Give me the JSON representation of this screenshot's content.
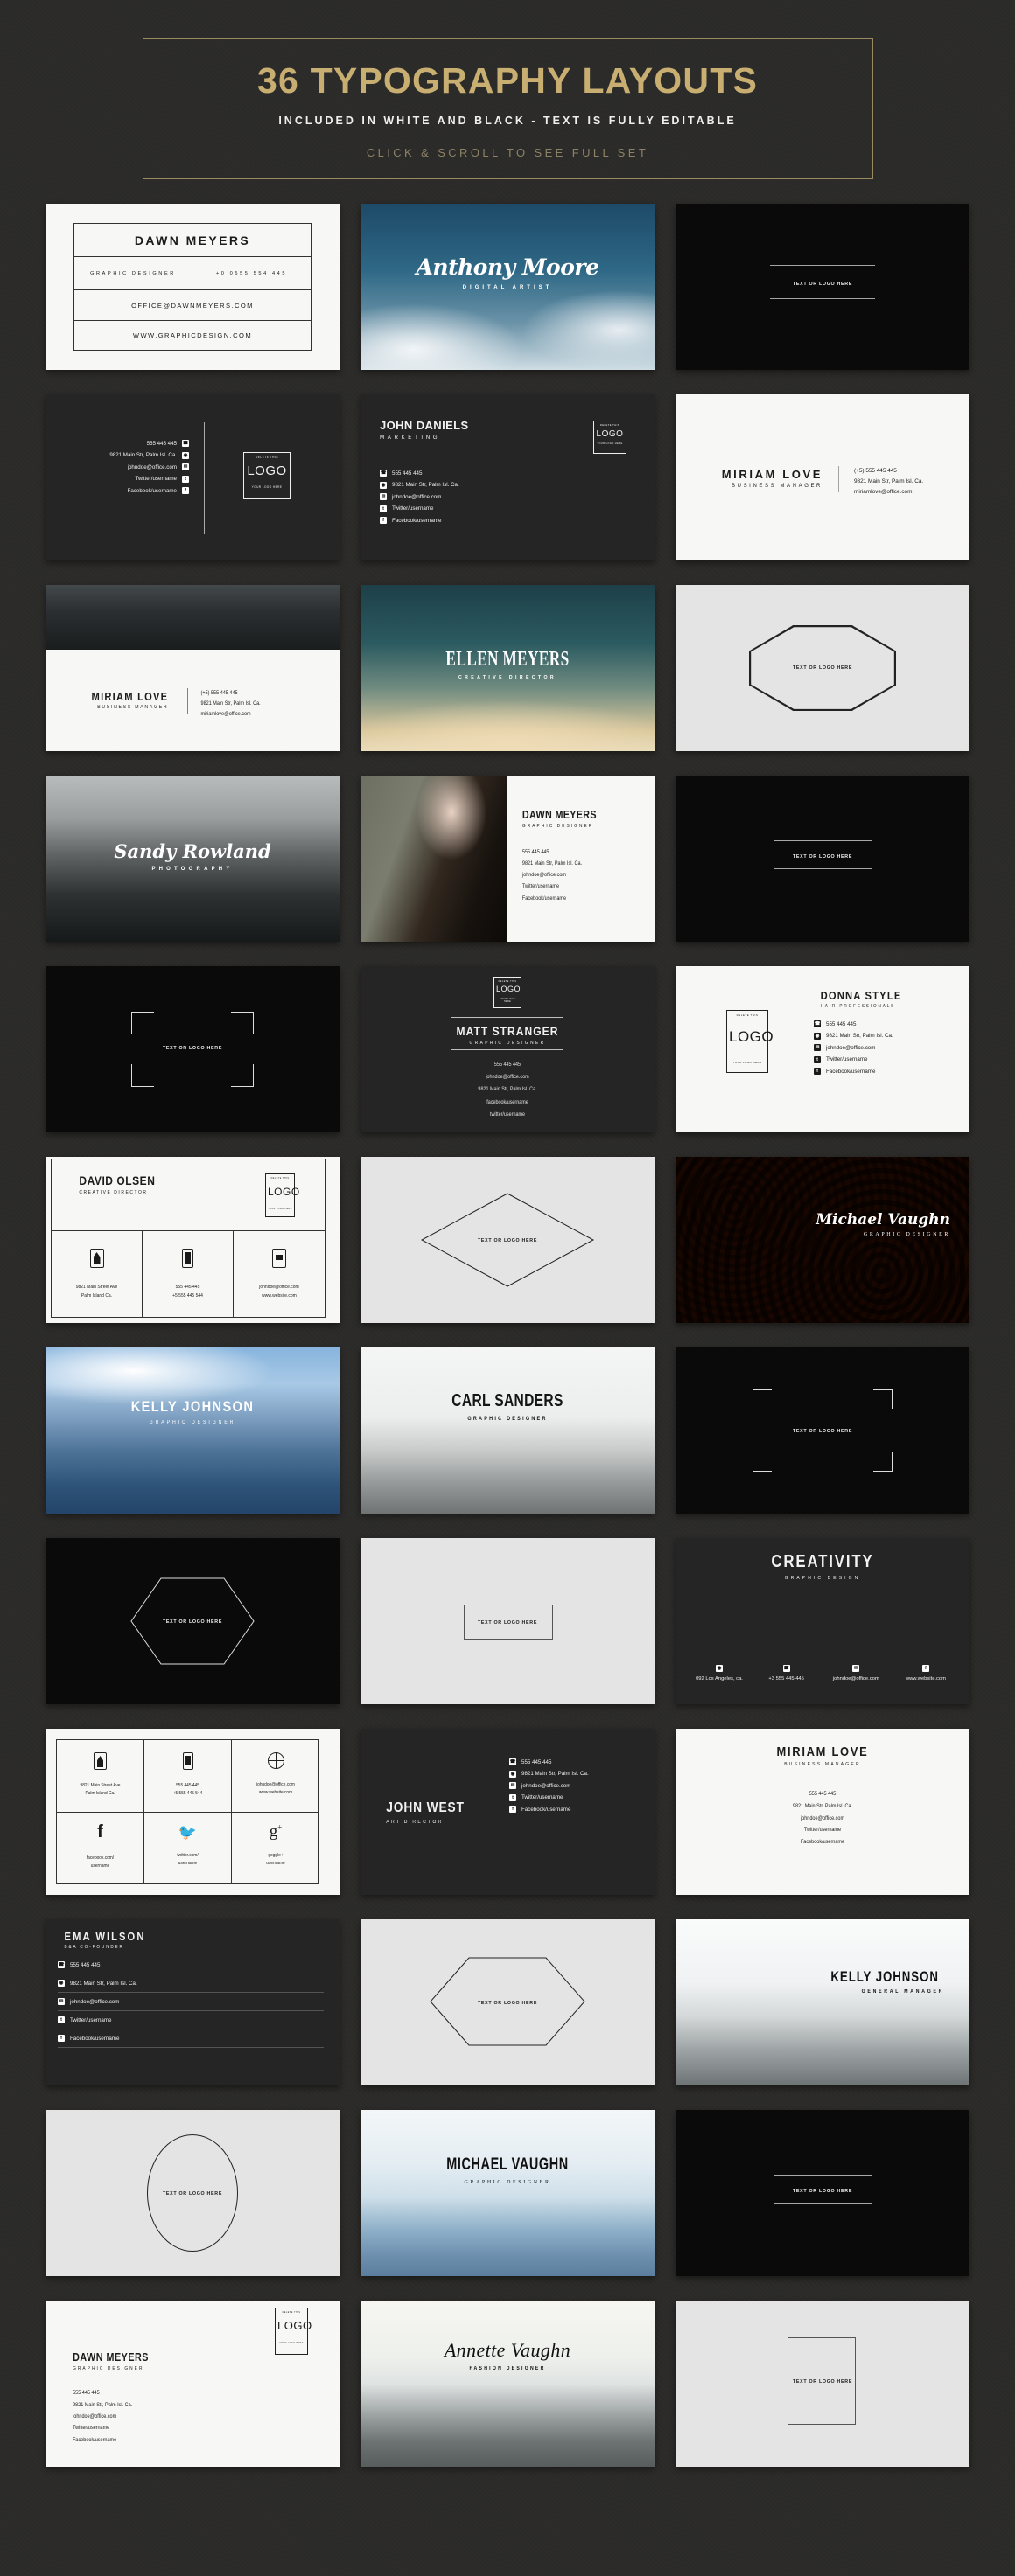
{
  "header": {
    "title": "36 TYPOGRAPHY LAYOUTS",
    "subtitle": "INCLUDED IN WHITE AND BLACK - TEXT IS FULLY EDITABLE",
    "cta": "CLICK & SCROLL TO SEE FULL SET",
    "accent_color": "#c9ae72",
    "border_color": "#9a8a5f",
    "background_color": "#2b2a28"
  },
  "placeholder": {
    "text_or_logo": "TEXT OR LOGO HERE",
    "delete_this": "DELETE THIS",
    "logo": "LOGO",
    "your_logo_here": "YOUR LOGO HERE"
  },
  "contact": {
    "phone": "555 445 445",
    "phone_plus": "(+5) 555 445 445",
    "phone_plus0": "+0 0555 554 445",
    "phone_plus3": "+3 555 445 445",
    "phone_alt": "+5 555 445 544",
    "address": "9821 Main Str, Palm Isl. Ca.",
    "address_ave": "9821 Main Street Ave",
    "address_city": "Palm Island Ca.",
    "address_la": "092 Los Angeles, ca.",
    "email": "johndoe@office.com",
    "email_office": "OFFICE@DAWNMEYERS.COM",
    "email_miriam": "miriamlove@office.com",
    "twitter": "Twitter/username",
    "twitter_lc": "twitter/username",
    "facebook": "Facebook/username",
    "facebook_lc": "facebook/username",
    "website": "www.website.com",
    "website_caps": "WWW.GRAPHICDESIGN.COM",
    "facebook_url": "facebook.com/",
    "twitter_url": "twitter.com/",
    "google_url": "goggle+",
    "username": "username"
  },
  "cards": [
    {
      "id": 1,
      "name": "DAWN MEYERS",
      "role": "GRAPHIC DESIGNER",
      "style": "boxed-table-white",
      "theme": "white"
    },
    {
      "id": 2,
      "name": "Anthony Moore",
      "role": "DIGITAL ARTIST",
      "style": "photo-script-sky",
      "theme": "photo"
    },
    {
      "id": 3,
      "name": "",
      "role": "",
      "style": "black-lines-placeholder",
      "theme": "black"
    },
    {
      "id": 4,
      "name": "",
      "role": "",
      "style": "dark-contacts-right-logo",
      "theme": "dark"
    },
    {
      "id": 5,
      "name": "JOHN DANIELS",
      "role": "MARKETING",
      "style": "dark-header-contacts-logo",
      "theme": "dark"
    },
    {
      "id": 6,
      "name": "MIRIAM LOVE",
      "role": "BUSINESS MANAGER",
      "style": "white-split-divider",
      "theme": "white"
    },
    {
      "id": 7,
      "name": "MIRIAM LOVE",
      "role": "BUSINESS MANAGER",
      "style": "photo-top-white-bottom",
      "theme": "white"
    },
    {
      "id": 8,
      "name": "ELLEN MEYERS",
      "role": "CREATIVE DIRECTOR",
      "style": "photo-dusk-serif",
      "theme": "photo"
    },
    {
      "id": 9,
      "name": "",
      "role": "",
      "style": "octagon-placeholder",
      "theme": "offwhite"
    },
    {
      "id": 10,
      "name": "Sandy Rowland",
      "role": "PHOTOGRAPHY",
      "style": "photo-script-mountain",
      "theme": "photo"
    },
    {
      "id": 11,
      "name": "DAWN MEYERS",
      "role": "GRAPHIC DESIGNER",
      "style": "portrait-left-info-right",
      "theme": "white"
    },
    {
      "id": 12,
      "name": "",
      "role": "",
      "style": "black-two-rules-placeholder",
      "theme": "black"
    },
    {
      "id": 13,
      "name": "",
      "role": "",
      "style": "black-corner-brackets",
      "theme": "black"
    },
    {
      "id": 14,
      "name": "MATT STRANGER",
      "role": "GRAPHIC DESIGNER",
      "style": "dark-centered-logo-top",
      "theme": "dark"
    },
    {
      "id": 15,
      "name": "DONNA STYLE",
      "role": "HAIR PROFESSIONALS",
      "style": "white-logo-left-contacts",
      "theme": "white"
    },
    {
      "id": 16,
      "name": "DAVID OLSEN",
      "role": "CREATIVE DIRECTOR",
      "style": "white-grid-icons",
      "theme": "white"
    },
    {
      "id": 17,
      "name": "",
      "role": "",
      "style": "diamond-placeholder",
      "theme": "offwhite"
    },
    {
      "id": 18,
      "name": "Michael Vaughn",
      "role": "GRAPHIC DESIGNER",
      "style": "photo-coffee-script",
      "theme": "photo"
    },
    {
      "id": 19,
      "name": "KELLY JOHNSON",
      "role": "GRAPHIC DESIGNER",
      "style": "photo-blue-mountain",
      "theme": "photo"
    },
    {
      "id": 20,
      "name": "CARL SANDERS",
      "role": "GRAPHIC DESIGNER",
      "style": "photo-grey-mountain",
      "theme": "photo"
    },
    {
      "id": 21,
      "name": "",
      "role": "",
      "style": "black-corner-brackets-wide",
      "theme": "black"
    },
    {
      "id": 22,
      "name": "",
      "role": "",
      "style": "black-hexagon-placeholder",
      "theme": "black"
    },
    {
      "id": 23,
      "name": "",
      "role": "",
      "style": "rect-placeholder-offwhite",
      "theme": "offwhite"
    },
    {
      "id": 24,
      "name": "CREATIVITY",
      "role": "GRAPHIC DESIGN",
      "style": "dark-footer-icons",
      "theme": "dark"
    },
    {
      "id": 25,
      "name": "",
      "role": "",
      "style": "white-icon-matrix",
      "theme": "white"
    },
    {
      "id": 26,
      "name": "JOHN WEST",
      "role": "ART DIRECTOR",
      "style": "dark-left-name-right-contacts",
      "theme": "dark"
    },
    {
      "id": 27,
      "name": "MIRIAM LOVE",
      "role": "BUSINESS MANAGER",
      "style": "white-centered-stack",
      "theme": "white"
    },
    {
      "id": 28,
      "name": "EMA WILSON",
      "role": "B&A CO-FOUNDER",
      "style": "dark-ruled-contacts",
      "theme": "dark"
    },
    {
      "id": 29,
      "name": "",
      "role": "",
      "style": "hexagon-wide-placeholder",
      "theme": "offwhite"
    },
    {
      "id": 30,
      "name": "KELLY JOHNSON",
      "role": "GENERAL MANAGER",
      "style": "photo-white-mountain",
      "theme": "photo"
    },
    {
      "id": 31,
      "name": "",
      "role": "",
      "style": "ellipse-placeholder",
      "theme": "offwhite"
    },
    {
      "id": 32,
      "name": "MICHAEL VAUGHN",
      "role": "GRAPHIC DESIGNER",
      "style": "photo-light-blue-mountain",
      "theme": "photo"
    },
    {
      "id": 33,
      "name": "",
      "role": "",
      "style": "black-two-rules-placeholder-2",
      "theme": "black"
    },
    {
      "id": 34,
      "name": "DAWN MEYERS",
      "role": "GRAPHIC DESIGNER",
      "style": "white-logo-topright-contacts",
      "theme": "white"
    },
    {
      "id": 35,
      "name": "Annette Vaughn",
      "role": "FASHION DESIGNER",
      "style": "photo-rock-serif-script",
      "theme": "photo"
    },
    {
      "id": 36,
      "name": "",
      "role": "",
      "style": "vertical-rect-placeholder",
      "theme": "offwhite"
    }
  ],
  "icons": {
    "phone": "phone-icon",
    "location": "location-pin-icon",
    "email": "envelope-icon",
    "twitter": "twitter-icon",
    "facebook": "facebook-icon",
    "google": "google-plus-icon",
    "home": "home-icon",
    "mobile": "mobile-icon",
    "globe": "globe-icon"
  }
}
